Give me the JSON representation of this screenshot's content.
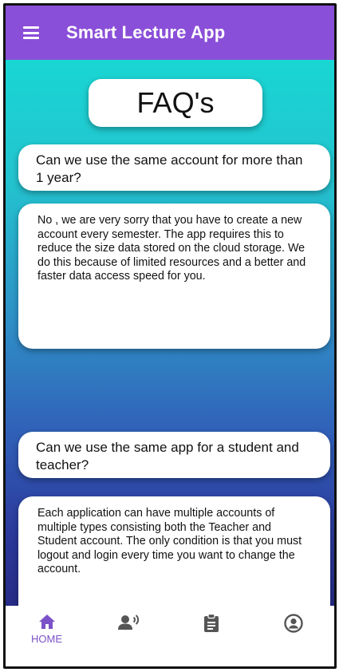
{
  "app_bar": {
    "title": "Smart Lecture App",
    "menu_icon": "hamburger-menu-icon"
  },
  "page": {
    "heading": "FAQ's"
  },
  "faqs": [
    {
      "question": "Can we use the same account for more than 1 year?",
      "answer": "No , we are very sorry that you have to create a new account every semester. The app requires this to reduce the size data stored on the cloud storage. We do this because of limited resources and a better and faster data access speed for you."
    },
    {
      "question": "Can we use the same app for a student and teacher?",
      "answer": "Each application can have multiple accounts of multiple types consisting both the Teacher and Student account. The only condition is that you must logout and login every time you want to change the account."
    }
  ],
  "bottom_nav": {
    "items": [
      {
        "label": "HOME",
        "icon": "home-icon",
        "active": true
      },
      {
        "label": "",
        "icon": "lecture-speaker-icon",
        "active": false
      },
      {
        "label": "",
        "icon": "clipboard-icon",
        "active": false
      },
      {
        "label": "",
        "icon": "account-icon",
        "active": false
      }
    ]
  },
  "colors": {
    "app_bar": "#8a4fd8",
    "accent": "#7b52c7",
    "gradient_top": "#19d6d3",
    "gradient_bottom": "#262b86",
    "inactive_icon": "#555555"
  }
}
